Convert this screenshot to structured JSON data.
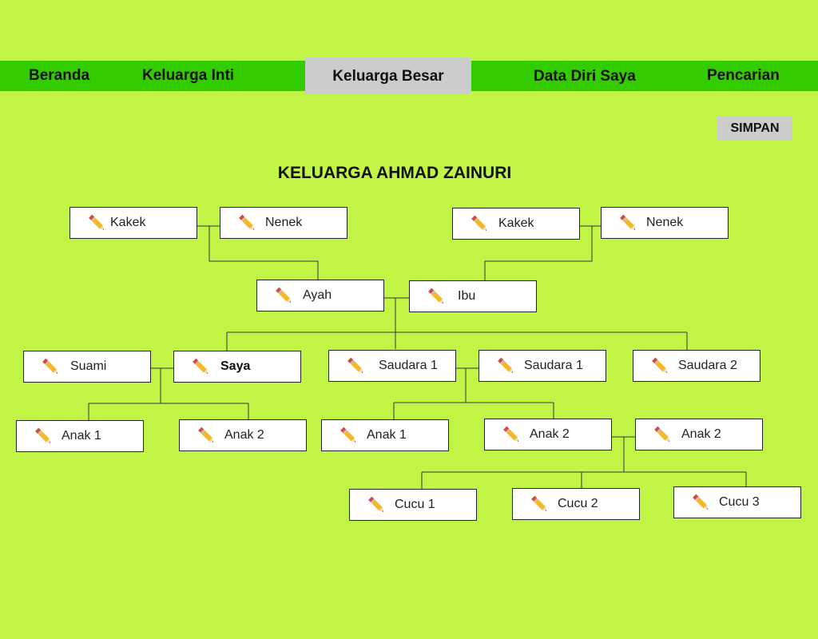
{
  "nav": {
    "tabs": [
      {
        "label": "Beranda",
        "active": false
      },
      {
        "label": "Keluarga Inti",
        "active": false
      },
      {
        "label": "Keluarga Besar",
        "active": true
      },
      {
        "label": "Data Diri Saya",
        "active": false
      },
      {
        "label": "Pencarian",
        "active": false
      }
    ]
  },
  "toolbar": {
    "save_label": "SIMPAN"
  },
  "page": {
    "title": "KELUARGA AHMAD ZAINURI"
  },
  "icon": "pencil-edit-icon",
  "colors": {
    "background": "#c1f444",
    "navbar": "#33cc00",
    "active_tab": "#cccccc",
    "card": "#ffffff",
    "line": "#2b3a4a"
  },
  "people": [
    {
      "id": "kakek-ayah",
      "label": "Kakek"
    },
    {
      "id": "nenek-ayah",
      "label": "Nenek"
    },
    {
      "id": "kakek-ibu",
      "label": "Kakek"
    },
    {
      "id": "nenek-ibu",
      "label": "Nenek"
    },
    {
      "id": "ayah",
      "label": "Ayah"
    },
    {
      "id": "ibu",
      "label": "Ibu"
    },
    {
      "id": "suami",
      "label": "Suami"
    },
    {
      "id": "saya",
      "label": "Saya"
    },
    {
      "id": "saudara-1-a",
      "label": "Saudara 1"
    },
    {
      "id": "saudara-1-b",
      "label": "Saudara 1"
    },
    {
      "id": "saudara-2",
      "label": "Saudara 2"
    },
    {
      "id": "anak-1-saya",
      "label": "Anak 1"
    },
    {
      "id": "anak-2-saya",
      "label": "Anak 2"
    },
    {
      "id": "anak-1-saudara",
      "label": "Anak 1"
    },
    {
      "id": "anak-2-saudara-a",
      "label": "Anak 2"
    },
    {
      "id": "anak-2-saudara-b",
      "label": "Anak 2"
    },
    {
      "id": "cucu-1",
      "label": "Cucu 1"
    },
    {
      "id": "cucu-2",
      "label": "Cucu 2"
    },
    {
      "id": "cucu-3",
      "label": "Cucu 3"
    }
  ]
}
